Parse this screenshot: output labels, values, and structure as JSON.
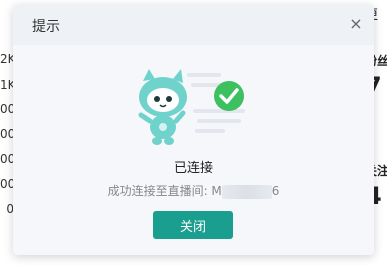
{
  "background": {
    "left_ticks": [
      "2K",
      "1K",
      "00",
      "00",
      "00",
      "00",
      "0"
    ],
    "right_labels": {
      "top": "更",
      "metric1_label": "粉丝",
      "metric1_value": "7",
      "metric2_label": "关注",
      "metric2_value": "4"
    }
  },
  "modal": {
    "title": "提示",
    "close_glyph": "×",
    "status_title": "已连接",
    "status_desc_prefix": "成功连接至直播间: M",
    "status_desc_suffix": "6",
    "close_button_label": "关闭"
  },
  "colors": {
    "primary": "#1a9e90",
    "check_badge": "#3cc060",
    "mascot": "#6fd3cc"
  }
}
